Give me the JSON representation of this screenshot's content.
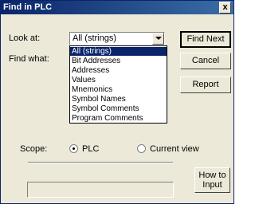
{
  "window": {
    "title": "Find in PLC",
    "close_glyph": "x"
  },
  "labels": {
    "look_at": "Look at:",
    "find_what": "Find what:",
    "scope": "Scope:"
  },
  "look_at": {
    "selected": "All (strings)",
    "options": [
      "All (strings)",
      "Bit Addresses",
      "Addresses",
      "Values",
      "Mnemonics",
      "Symbol Names",
      "Symbol Comments",
      "Program Comments"
    ]
  },
  "buttons": {
    "find_next": "Find Next",
    "cancel": "Cancel",
    "report": "Report",
    "how_to_line1": "How to",
    "how_to_line2": "Input"
  },
  "scope": {
    "plc": "PLC",
    "current_view": "Current view",
    "selected": "plc"
  },
  "find_what_value": "",
  "colors": {
    "selection": "#0a246a",
    "face": "#ece9d8",
    "titlebar": "#0a246a"
  }
}
